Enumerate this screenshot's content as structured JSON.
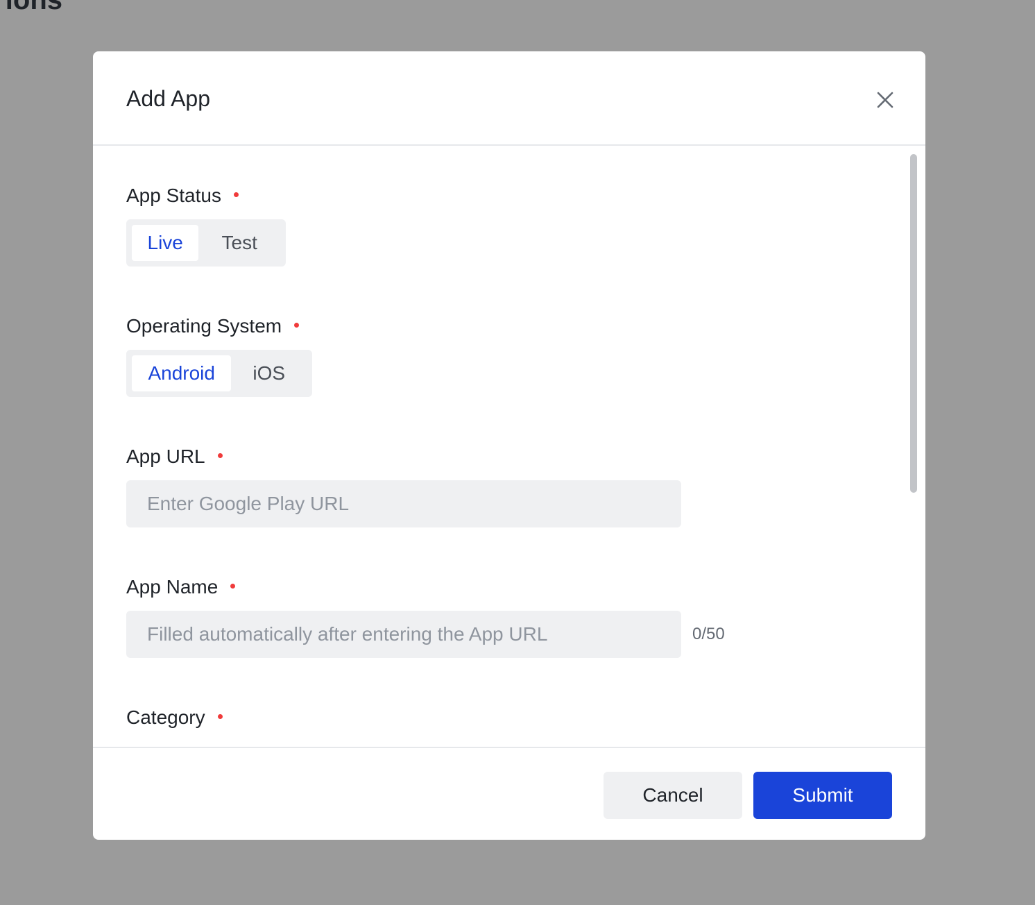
{
  "background": {
    "title_fragment": "ions"
  },
  "dialog": {
    "title": "Add App",
    "close_icon": "close-icon"
  },
  "form": {
    "app_status": {
      "label": "App Status",
      "required": true,
      "options": [
        "Live",
        "Test"
      ],
      "selected": "Live"
    },
    "operating_system": {
      "label": "Operating System",
      "required": true,
      "options": [
        "Android",
        "iOS"
      ],
      "selected": "Android"
    },
    "app_url": {
      "label": "App URL",
      "required": true,
      "value": "",
      "placeholder": "Enter Google Play URL"
    },
    "app_name": {
      "label": "App Name",
      "required": true,
      "value": "",
      "placeholder": "Filled automatically after entering the App URL",
      "char_count": "0/50"
    },
    "category": {
      "label": "Category",
      "required": true
    }
  },
  "footer": {
    "cancel_label": "Cancel",
    "submit_label": "Submit"
  },
  "colors": {
    "accent": "#1a44d9",
    "required": "#f03b3b",
    "overlay": "#9b9b9b"
  }
}
